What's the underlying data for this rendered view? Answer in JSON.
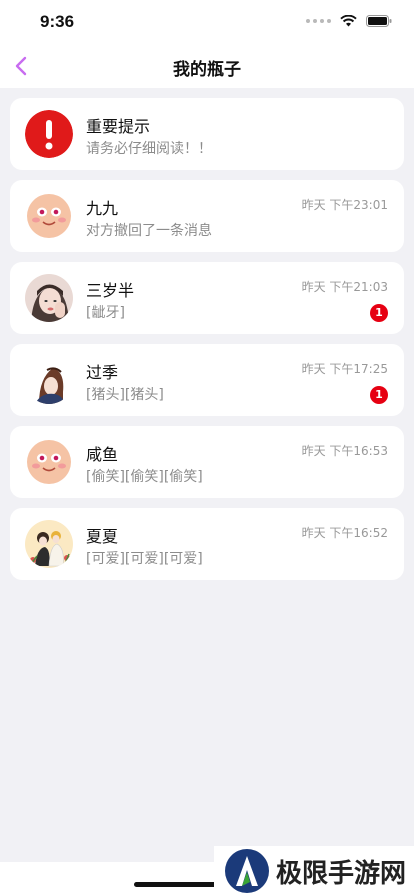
{
  "status_bar": {
    "time": "9:36"
  },
  "nav": {
    "title": "我的瓶子"
  },
  "conversations": [
    {
      "name": "重要提示",
      "message": "请务必仔细阅读！！",
      "time": "",
      "badge": "",
      "avatar": "alert-icon"
    },
    {
      "name": "九九",
      "message": "对方撤回了一条消息",
      "time": "昨天 下午23:01",
      "badge": "",
      "avatar": "smiley-face-avatar"
    },
    {
      "name": "三岁半",
      "message": "[龇牙]",
      "time": "昨天 下午21:03",
      "badge": "1",
      "avatar": "photo-avatar-girl"
    },
    {
      "name": "过季",
      "message": "[猪头][猪头]",
      "time": "昨天 下午17:25",
      "badge": "1",
      "avatar": "illustration-avatar-girl"
    },
    {
      "name": "咸鱼",
      "message": "[偷笑][偷笑][偷笑]",
      "time": "昨天 下午16:53",
      "badge": "",
      "avatar": "smiley-face-avatar"
    },
    {
      "name": "夏夏",
      "message": "[可爱][可爱][可爱]",
      "time": "昨天 下午16:52",
      "badge": "",
      "avatar": "illustration-avatar-couple"
    }
  ],
  "watermark": {
    "text": "极限手游网"
  },
  "colors": {
    "accent": "#c86cf0",
    "badge": "#e60012",
    "alert": "#e01a1a",
    "background": "#f1f1f5"
  }
}
